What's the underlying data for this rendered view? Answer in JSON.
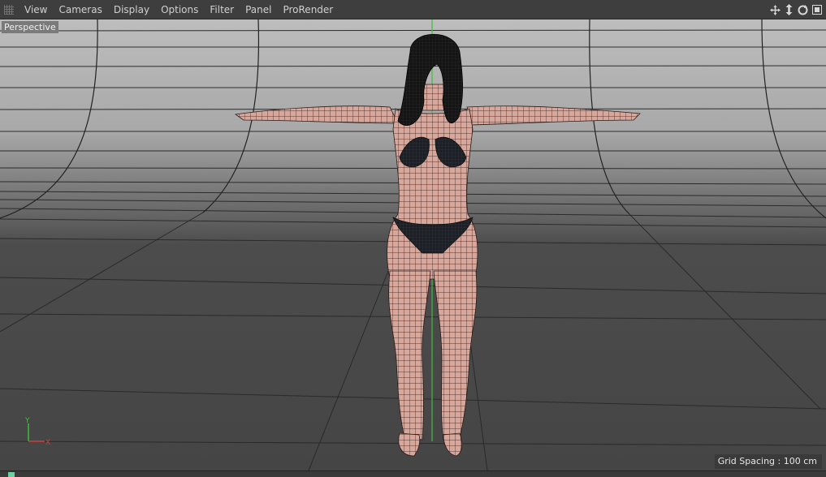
{
  "menubar": {
    "items": [
      "View",
      "Cameras",
      "Display",
      "Options",
      "Filter",
      "Panel",
      "ProRender"
    ],
    "nav_icons": [
      "move-view-icon",
      "dolly-view-icon",
      "rotate-view-icon",
      "toggle-panel-icon"
    ]
  },
  "viewport": {
    "camera_label": "Perspective",
    "grid_spacing": "Grid Spacing : 100 cm",
    "axis_labels": {
      "y": "Y",
      "x": "X"
    }
  },
  "colors": {
    "background_top": "#b9b9b9",
    "floor": "#474747",
    "skin_wire": "#c9968d",
    "hair": "#1a1a1a",
    "y_axis": "#3fbf3f",
    "x_axis": "#d04040"
  }
}
